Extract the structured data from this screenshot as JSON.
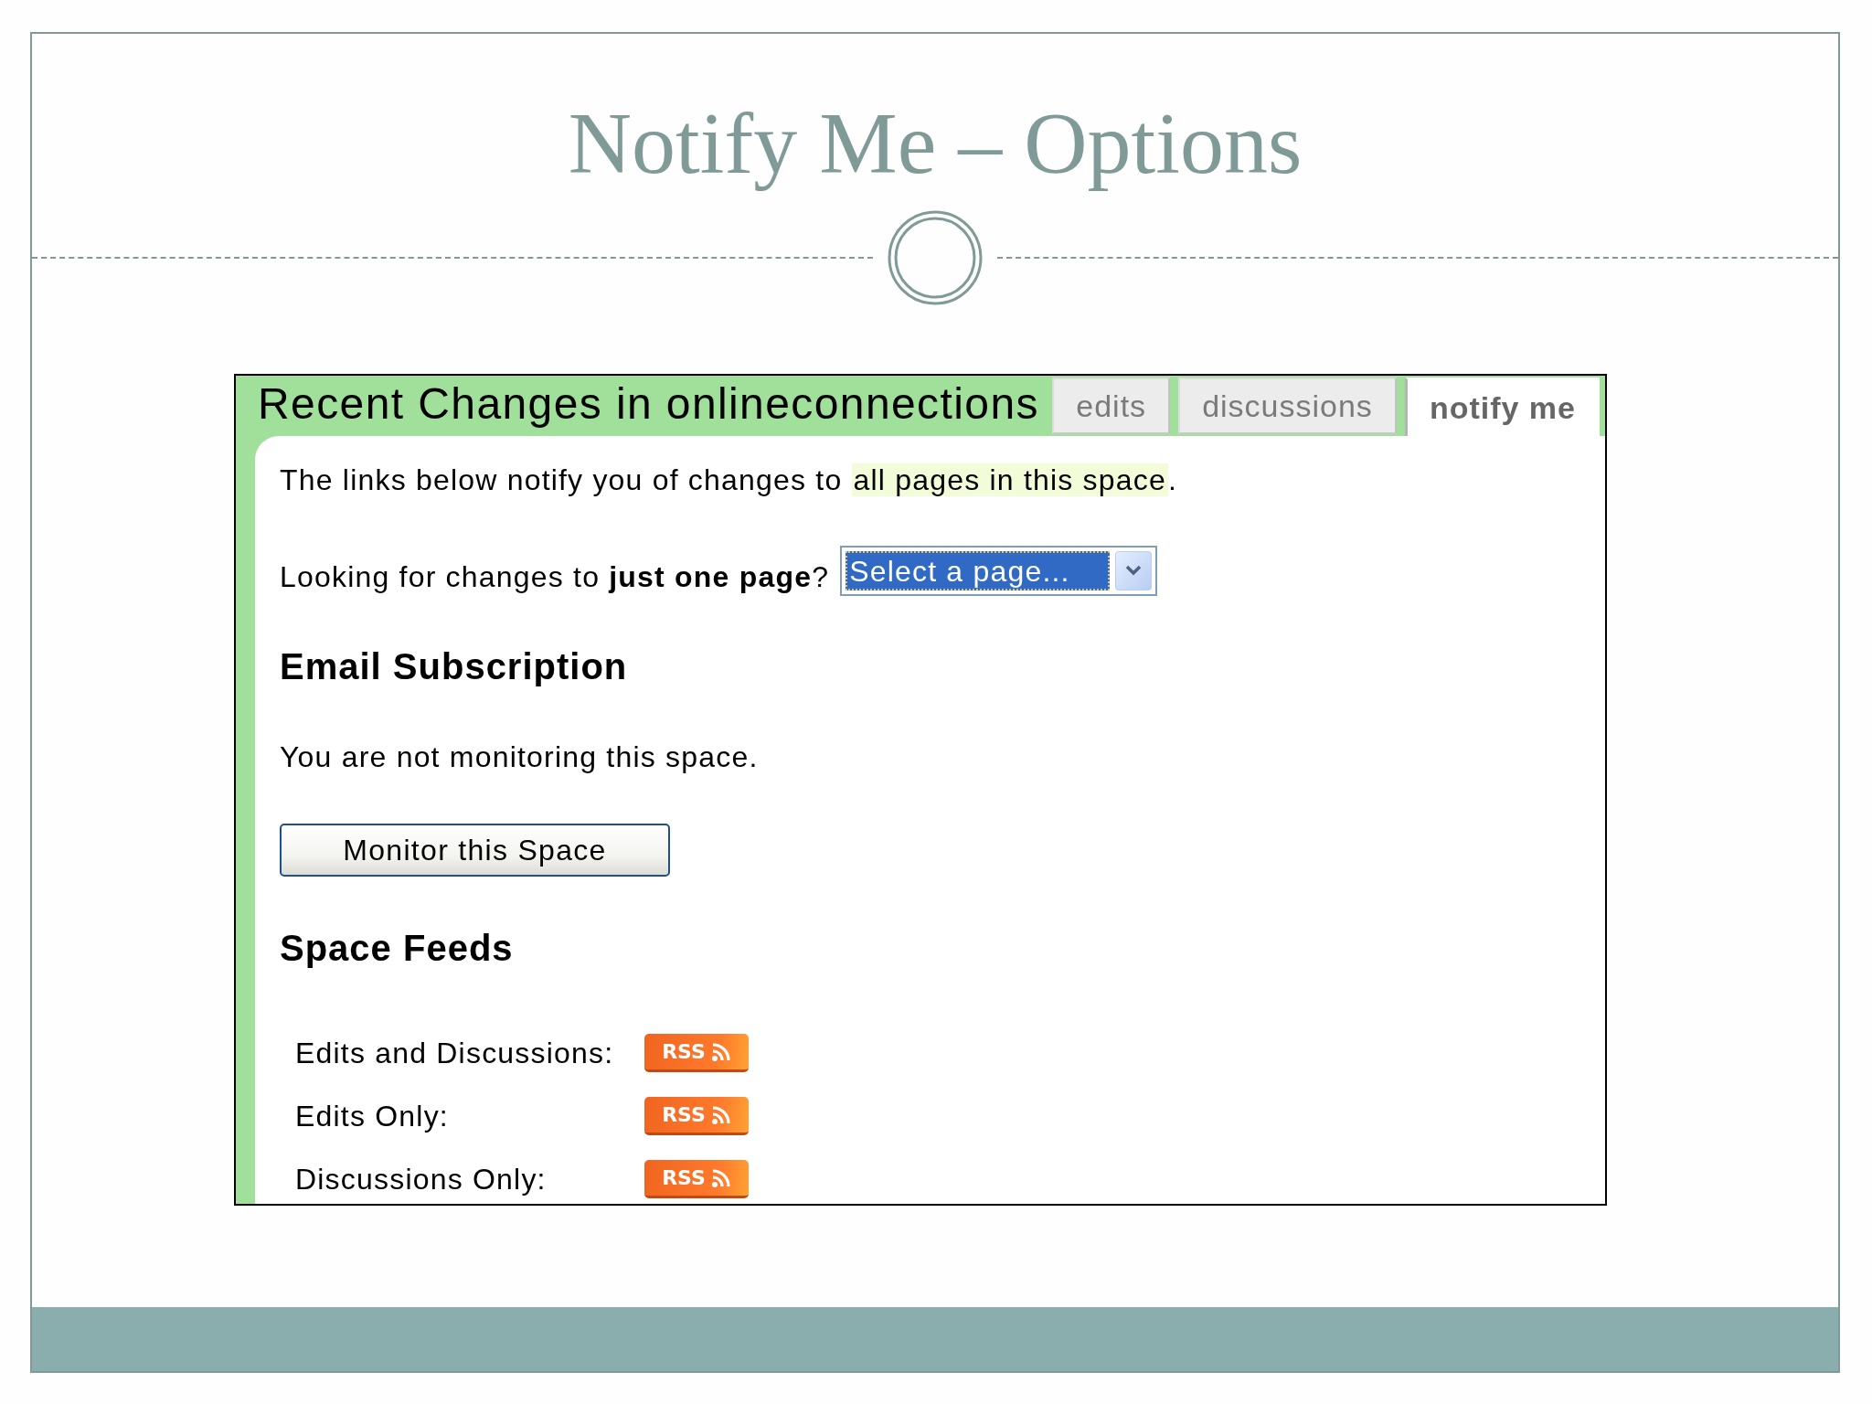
{
  "slide": {
    "title": "Notify Me – Options"
  },
  "screenshot": {
    "heading": "Recent Changes in onlineconnections",
    "tabs": [
      {
        "label": "edits",
        "selected": false
      },
      {
        "label": "discussions",
        "selected": false
      },
      {
        "label": "notify me",
        "selected": true
      }
    ],
    "intro": {
      "before": "The links below notify you of changes to",
      "highlighted": "all pages in this space",
      "after": "."
    },
    "page_question": "Looking for changes to **just one page**?",
    "page_select": {
      "value": "Select a page...",
      "focused": true
    },
    "email_subscription": {
      "heading": "Email Subscription",
      "status": "You are not monitoring this space.",
      "button": "Monitor this Space"
    },
    "space_feeds": {
      "heading": "Space Feeds",
      "feeds": [
        {
          "label": "Edits and Discussions:",
          "badge": "RSS"
        },
        {
          "label": "Edits Only:",
          "badge": "RSS"
        },
        {
          "label": "Discussions Only:",
          "badge": "RSS"
        }
      ]
    }
  }
}
